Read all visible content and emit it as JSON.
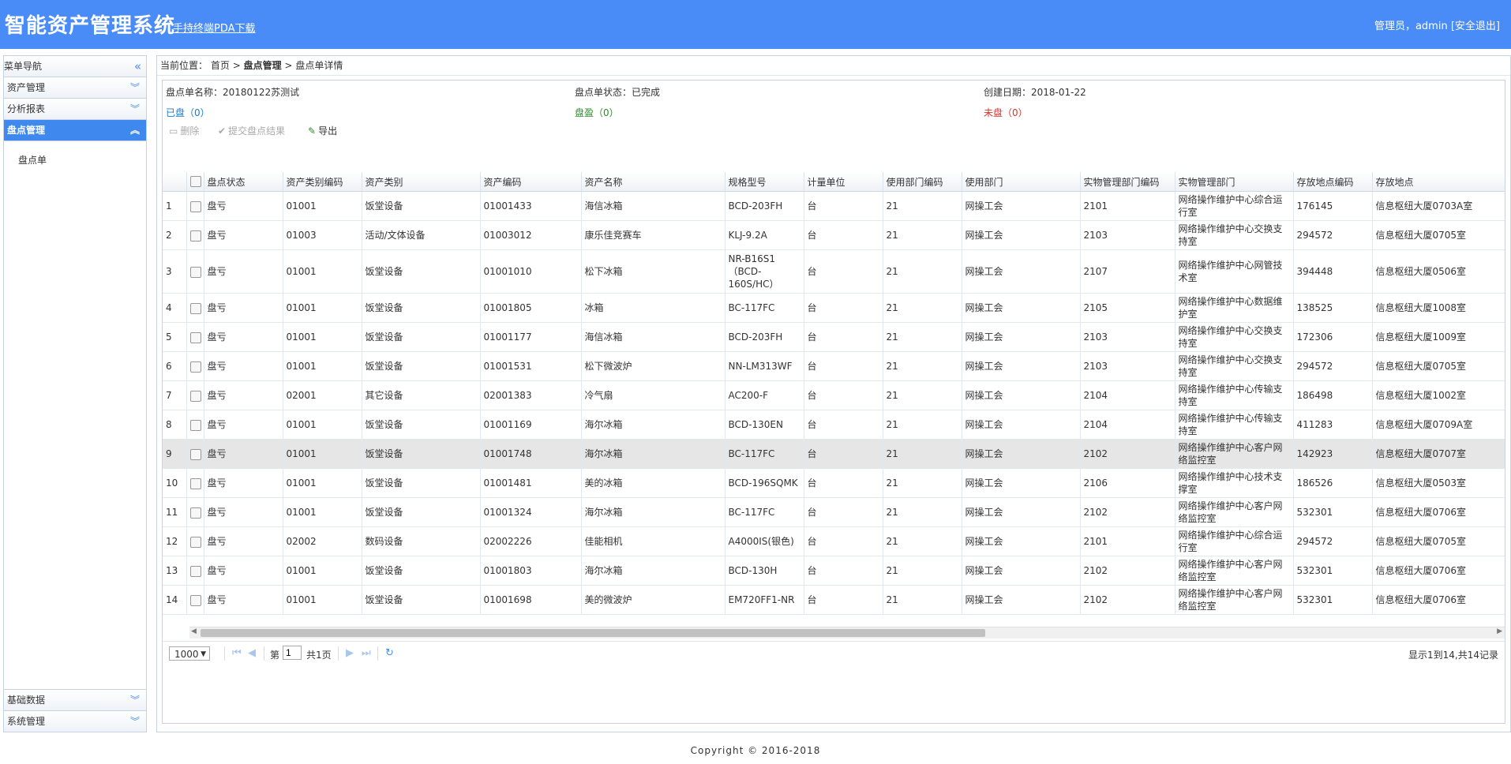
{
  "header": {
    "title": "智能资产管理系统",
    "pda_link": "手持终端PDA下载",
    "user_label": "管理员，admin",
    "logout": "[安全退出]"
  },
  "sidebar": {
    "title": "菜单导航",
    "collapse_icon": "double-chevron-left-icon",
    "sections": [
      {
        "label": "资产管理",
        "active": false
      },
      {
        "label": "分析报表",
        "active": false
      },
      {
        "label": "盘点管理",
        "active": true
      }
    ],
    "submenu": [
      "盘点单"
    ],
    "bottom_sections": [
      {
        "label": "基础数据"
      },
      {
        "label": "系统管理"
      }
    ]
  },
  "breadcrumb": {
    "prefix": "当前位置：",
    "home": "首页",
    "sep": ">",
    "level1": "盘点管理",
    "level2": "盘点单详情"
  },
  "info": {
    "name_label": "盘点单名称：",
    "name_value": "20180122苏测试",
    "status_label": "盘点单状态：",
    "status_value": "已完成",
    "date_label": "创建日期：",
    "date_value": "2018-01-22",
    "checked": "已盘（0）",
    "surplus": "盘盈（0）",
    "unchecked": "未盘（0）"
  },
  "toolbar": {
    "delete": "删除",
    "submit": "提交盘点结果",
    "export": "导出"
  },
  "table": {
    "columns": [
      "盘点状态",
      "资产类别编码",
      "资产类别",
      "资产编码",
      "资产名称",
      "规格型号",
      "计量单位",
      "使用部门编码",
      "使用部门",
      "实物管理部门编码",
      "实物管理部门",
      "存放地点编码",
      "存放地点"
    ],
    "rows": [
      {
        "n": "1",
        "status": "盘亏",
        "cat_code": "01001",
        "cat": "饭堂设备",
        "code": "01001433",
        "name": "海信冰箱",
        "model": "BCD-203FH",
        "unit": "台",
        "dept_code": "21",
        "dept": "网操工会",
        "mgr_code": "2101",
        "mgr": "网络操作维护中心综合运行室",
        "loc_code": "176145",
        "loc": "信息枢纽大厦0703A室"
      },
      {
        "n": "2",
        "status": "盘亏",
        "cat_code": "01003",
        "cat": "活动/文体设备",
        "code": "01003012",
        "name": "康乐佳竞赛车",
        "model": "KLJ-9.2A",
        "unit": "台",
        "dept_code": "21",
        "dept": "网操工会",
        "mgr_code": "2103",
        "mgr": "网络操作维护中心交换支持室",
        "loc_code": "294572",
        "loc": "信息枢纽大厦0705室"
      },
      {
        "n": "3",
        "status": "盘亏",
        "cat_code": "01001",
        "cat": "饭堂设备",
        "code": "01001010",
        "name": "松下冰箱",
        "model": "NR-B16S1（BCD-160S/HC）",
        "unit": "台",
        "dept_code": "21",
        "dept": "网操工会",
        "mgr_code": "2107",
        "mgr": "网络操作维护中心网管技术室",
        "loc_code": "394448",
        "loc": "信息枢纽大厦0506室"
      },
      {
        "n": "4",
        "status": "盘亏",
        "cat_code": "01001",
        "cat": "饭堂设备",
        "code": "01001805",
        "name": "冰箱",
        "model": "BC-117FC",
        "unit": "台",
        "dept_code": "21",
        "dept": "网操工会",
        "mgr_code": "2105",
        "mgr": "网络操作维护中心数据维护室",
        "loc_code": "138525",
        "loc": "信息枢纽大厦1008室"
      },
      {
        "n": "5",
        "status": "盘亏",
        "cat_code": "01001",
        "cat": "饭堂设备",
        "code": "01001177",
        "name": "海信冰箱",
        "model": "BCD-203FH",
        "unit": "台",
        "dept_code": "21",
        "dept": "网操工会",
        "mgr_code": "2103",
        "mgr": "网络操作维护中心交换支持室",
        "loc_code": "172306",
        "loc": "信息枢纽大厦1009室"
      },
      {
        "n": "6",
        "status": "盘亏",
        "cat_code": "01001",
        "cat": "饭堂设备",
        "code": "01001531",
        "name": "松下微波炉",
        "model": "NN-LM313WF",
        "unit": "台",
        "dept_code": "21",
        "dept": "网操工会",
        "mgr_code": "2103",
        "mgr": "网络操作维护中心交换支持室",
        "loc_code": "294572",
        "loc": "信息枢纽大厦0705室"
      },
      {
        "n": "7",
        "status": "盘亏",
        "cat_code": "02001",
        "cat": "其它设备",
        "code": "02001383",
        "name": "冷气扇",
        "model": "AC200-F",
        "unit": "台",
        "dept_code": "21",
        "dept": "网操工会",
        "mgr_code": "2104",
        "mgr": "网络操作维护中心传输支持室",
        "loc_code": "186498",
        "loc": "信息枢纽大厦1002室"
      },
      {
        "n": "8",
        "status": "盘亏",
        "cat_code": "01001",
        "cat": "饭堂设备",
        "code": "01001169",
        "name": "海尔冰箱",
        "model": "BCD-130EN",
        "unit": "台",
        "dept_code": "21",
        "dept": "网操工会",
        "mgr_code": "2104",
        "mgr": "网络操作维护中心传输支持室",
        "loc_code": "411283",
        "loc": "信息枢纽大厦0709A室"
      },
      {
        "n": "9",
        "status": "盘亏",
        "cat_code": "01001",
        "cat": "饭堂设备",
        "code": "01001748",
        "name": "海尔冰箱",
        "model": "BC-117FC",
        "unit": "台",
        "dept_code": "21",
        "dept": "网操工会",
        "mgr_code": "2102",
        "mgr": "网络操作维护中心客户网络监控室",
        "loc_code": "142923",
        "loc": "信息枢纽大厦0707室"
      },
      {
        "n": "10",
        "status": "盘亏",
        "cat_code": "01001",
        "cat": "饭堂设备",
        "code": "01001481",
        "name": "美的冰箱",
        "model": "BCD-196SQMK",
        "unit": "台",
        "dept_code": "21",
        "dept": "网操工会",
        "mgr_code": "2106",
        "mgr": "网络操作维护中心技术支撑室",
        "loc_code": "186526",
        "loc": "信息枢纽大厦0503室"
      },
      {
        "n": "11",
        "status": "盘亏",
        "cat_code": "01001",
        "cat": "饭堂设备",
        "code": "01001324",
        "name": "海尔冰箱",
        "model": "BC-117FC",
        "unit": "台",
        "dept_code": "21",
        "dept": "网操工会",
        "mgr_code": "2102",
        "mgr": "网络操作维护中心客户网络监控室",
        "loc_code": "532301",
        "loc": "信息枢纽大厦0706室"
      },
      {
        "n": "12",
        "status": "盘亏",
        "cat_code": "02002",
        "cat": "数码设备",
        "code": "02002226",
        "name": "佳能相机",
        "model": "A4000IS(银色)",
        "unit": "台",
        "dept_code": "21",
        "dept": "网操工会",
        "mgr_code": "2101",
        "mgr": "网络操作维护中心综合运行室",
        "loc_code": "294572",
        "loc": "信息枢纽大厦0705室"
      },
      {
        "n": "13",
        "status": "盘亏",
        "cat_code": "01001",
        "cat": "饭堂设备",
        "code": "01001803",
        "name": "海尔冰箱",
        "model": "BCD-130H",
        "unit": "台",
        "dept_code": "21",
        "dept": "网操工会",
        "mgr_code": "2102",
        "mgr": "网络操作维护中心客户网络监控室",
        "loc_code": "532301",
        "loc": "信息枢纽大厦0706室"
      },
      {
        "n": "14",
        "status": "盘亏",
        "cat_code": "01001",
        "cat": "饭堂设备",
        "code": "01001698",
        "name": "美的微波炉",
        "model": "EM720FF1-NR",
        "unit": "台",
        "dept_code": "21",
        "dept": "网操工会",
        "mgr_code": "2102",
        "mgr": "网络操作维护中心客户网络监控室",
        "loc_code": "532301",
        "loc": "信息枢纽大厦0706室"
      }
    ],
    "selected_row": "9"
  },
  "pager": {
    "page_size": "1000",
    "page_prefix": "第",
    "page_value": "1",
    "page_suffix": "共1页",
    "summary": "显示1到14,共14记录"
  },
  "footer": {
    "copyright": "Copyright © 2016-2018"
  },
  "colors": {
    "header_bg": "#4a8cf7",
    "active_menu": "#3f89ee"
  }
}
